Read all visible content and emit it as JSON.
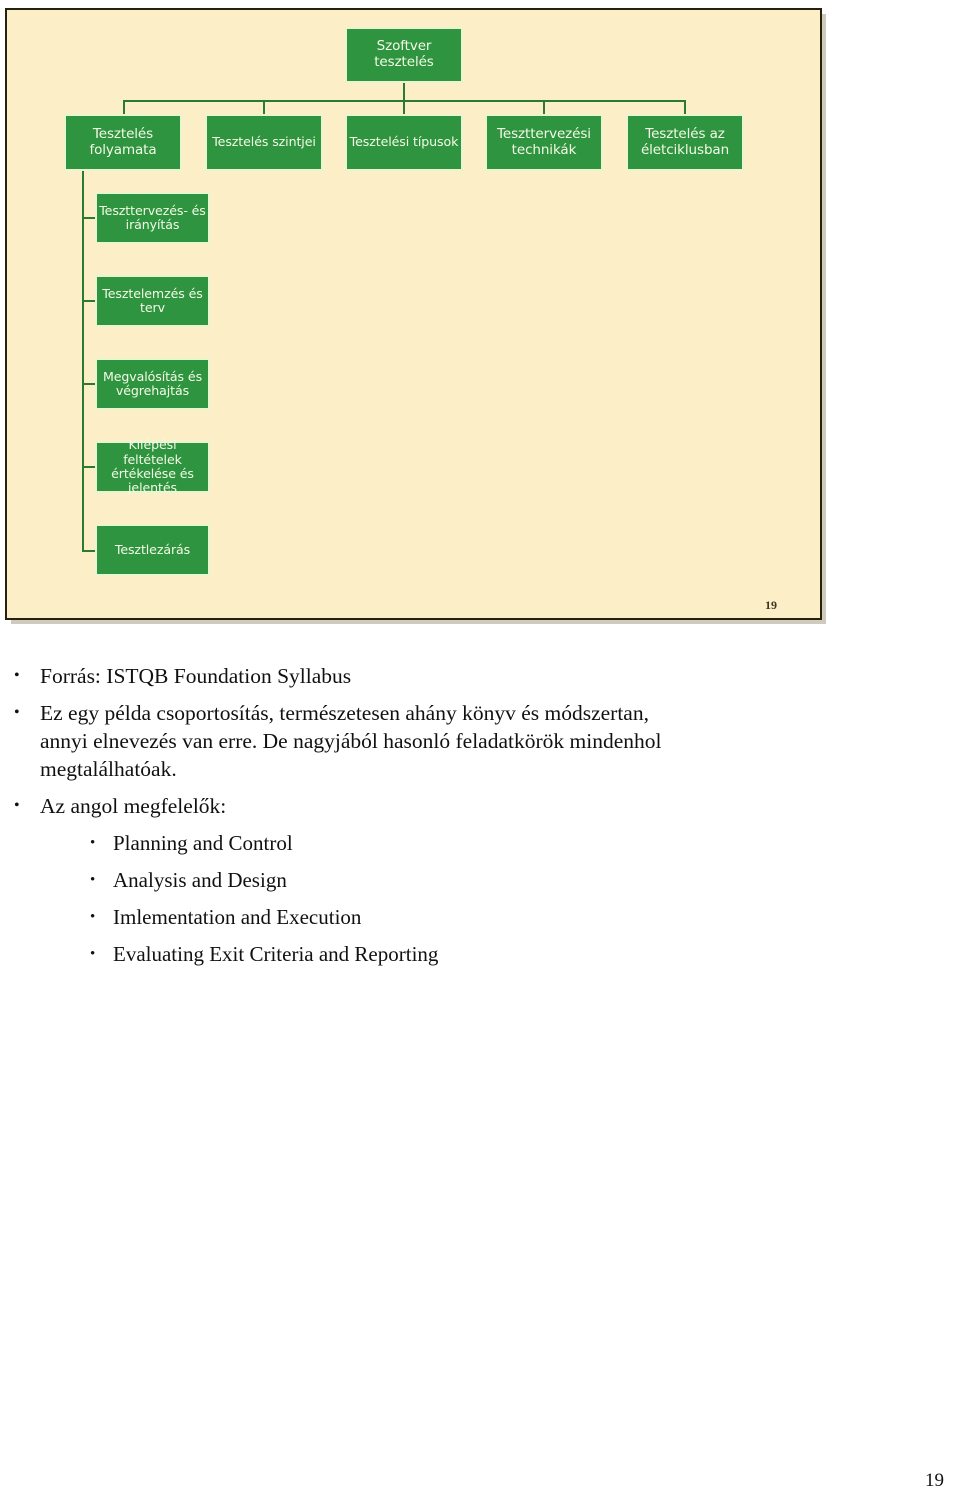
{
  "slide": {
    "page_number": "19",
    "background_color": "#fcefc7",
    "box_color": "#2e9440",
    "box_text_color": "#f4fbe4",
    "connector_color": "#2b7a33",
    "diagram": {
      "root": {
        "label": "Szoftver  tesztelés"
      },
      "level2": [
        {
          "label": "Tesztelés\nfolyamata"
        },
        {
          "label": "Tesztelés szintjei"
        },
        {
          "label": "Tesztelési típusok"
        },
        {
          "label": "Teszttervezési\ntechnikák"
        },
        {
          "label": "Tesztelés az\néletciklusban"
        }
      ],
      "process_steps": [
        {
          "label": "Teszttervezés- és\nirányítás"
        },
        {
          "label": "Tesztelemzés és\nterv"
        },
        {
          "label": "Megvalósítás  és\nvégrehajtás"
        },
        {
          "label": "Kilépési feltételek\nértékelése és\njelentés"
        },
        {
          "label": "Tesztlezárás"
        }
      ]
    }
  },
  "notes": {
    "bullets": [
      {
        "level": 1,
        "text": "Forrás: ISTQB Foundation Syllabus"
      },
      {
        "level": 1,
        "text": "Ez egy példa csoportosítás, természetesen ahány könyv és módszertan, annyi elnevezés van erre. De nagyjából hasonló feladatkörök mindenhol megtalálhatóak."
      },
      {
        "level": 1,
        "text": "Az angol megfelelők:"
      },
      {
        "level": 2,
        "text": "Planning and Control"
      },
      {
        "level": 2,
        "text": "Analysis and Design"
      },
      {
        "level": 2,
        "text": "Imlementation and Execution"
      },
      {
        "level": 2,
        "text": "Evaluating Exit Criteria and Reporting"
      }
    ],
    "bullet_glyph": "•"
  },
  "footer": {
    "page_number": "19"
  }
}
